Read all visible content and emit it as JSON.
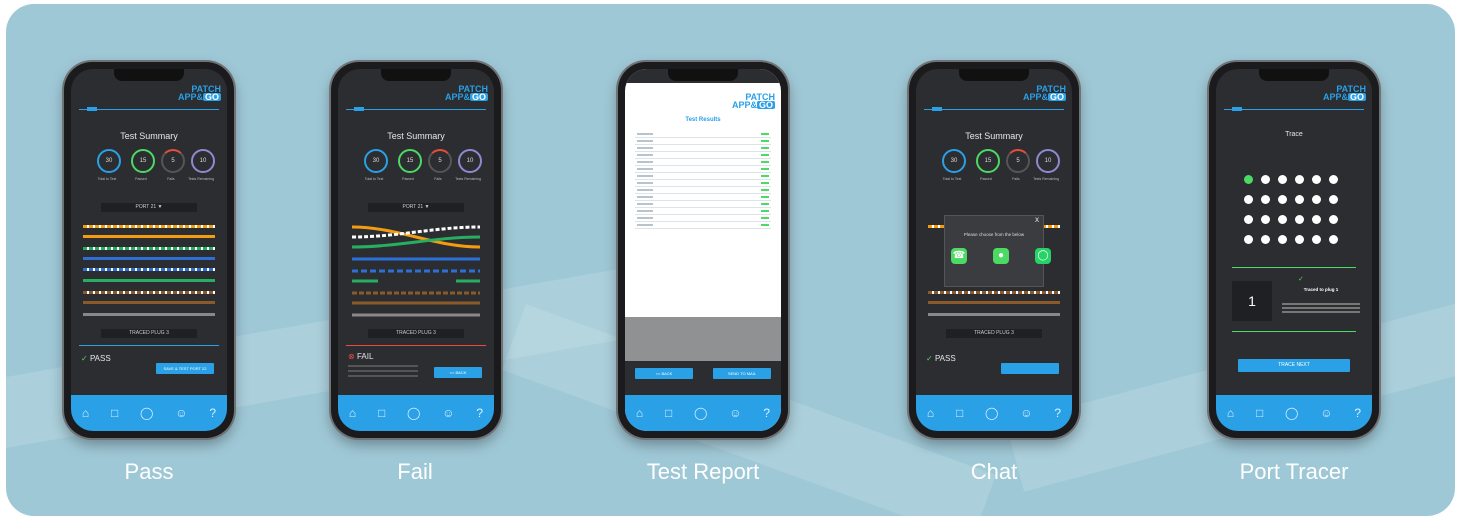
{
  "captions": [
    "Pass",
    "Fail",
    "Test Report",
    "Chat",
    "Port Tracer"
  ],
  "app": {
    "logo_top": "PATCH",
    "logo_bottom": "APP&",
    "logo_go": "GO"
  },
  "summary": {
    "title": "Test Summary",
    "total": "30",
    "passed": "15",
    "fails": "5",
    "remaining": "10",
    "labels": [
      "Total to Test",
      "Passed",
      "Fails",
      "Tests Remaining"
    ],
    "port": "PORT 21",
    "traced": "TRACED PLUG 3"
  },
  "pass_screen": {
    "status": "PASS",
    "button": "SAVE & TEST PORT 22"
  },
  "fail_screen": {
    "status": "FAIL",
    "button": "<< BACK"
  },
  "report": {
    "title": "Test Results",
    "back": "<< BACK",
    "send": "SEND TO MAIL"
  },
  "chat": {
    "prompt": "Please choose from the below",
    "close": "X",
    "status": "PASS"
  },
  "tracer": {
    "title": "Trace",
    "big_number": "1",
    "traced_msg": "Traced to plug 1",
    "button": "TRACE NEXT"
  },
  "nav_icons": [
    "home-icon",
    "folder-icon",
    "chat-icon",
    "user-icon",
    "help-icon"
  ],
  "colors": {
    "accent": "#2aa0e6",
    "pass_green": "#4cd964",
    "fail_red": "#e74c3c",
    "background": "#9fc8d6"
  }
}
